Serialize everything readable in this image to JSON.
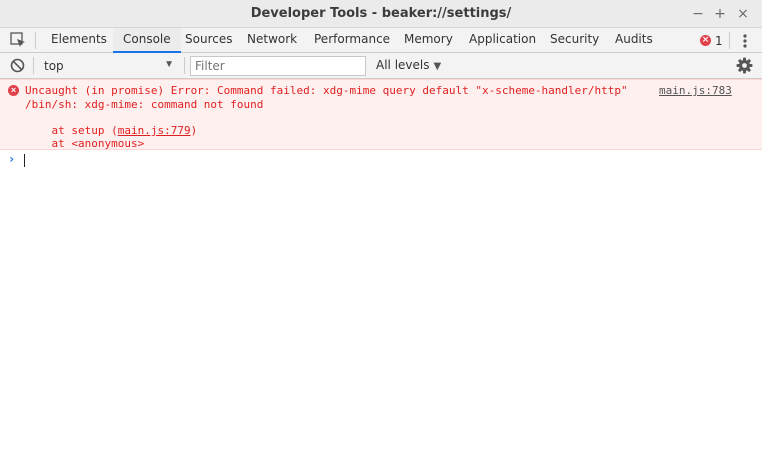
{
  "window": {
    "title": "Developer Tools - beaker://settings/",
    "minimize": "−",
    "maximize": "+",
    "close": "×"
  },
  "tabs": [
    {
      "label": "Elements"
    },
    {
      "label": "Console",
      "active": true
    },
    {
      "label": "Sources"
    },
    {
      "label": "Network"
    },
    {
      "label": "Performance"
    },
    {
      "label": "Memory"
    },
    {
      "label": "Application"
    },
    {
      "label": "Security"
    },
    {
      "label": "Audits"
    }
  ],
  "error_badge": {
    "glyph": "×",
    "count": "1"
  },
  "toolbar": {
    "context": "top",
    "filter_placeholder": "Filter",
    "filter_value": "",
    "levels": "All levels"
  },
  "console": {
    "error": {
      "line1": "Uncaught (in promise) Error: Command failed: xdg-mime query default \"x-scheme-handler/http\"",
      "line2": "/bin/sh: xdg-mime: command not found",
      "source": "main.js:783",
      "stack1_pre": "    at setup (",
      "stack1_link": "main.js:779",
      "stack1_post": ")",
      "stack2": "    at <anonymous>"
    },
    "prompt": "›"
  },
  "colors": {
    "accent": "#1a73e8",
    "error": "#e02020",
    "error_bg": "#fff0f0"
  }
}
